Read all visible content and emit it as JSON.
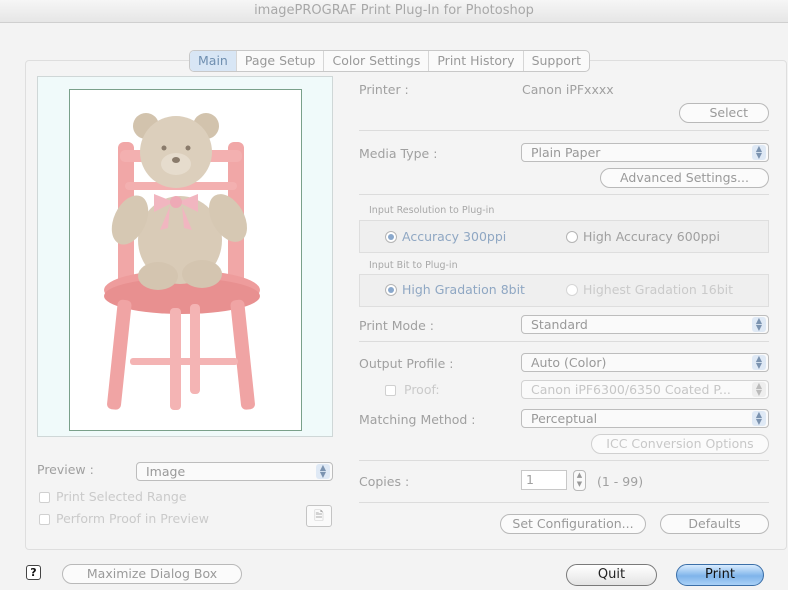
{
  "window": {
    "title": "imagePROGRAF Print Plug-In for Photoshop"
  },
  "tabs": [
    "Main",
    "Page Setup",
    "Color Settings",
    "Print History",
    "Support"
  ],
  "printer": {
    "label": "Printer :",
    "value": "Canon iPFxxxx",
    "select_button": "Select"
  },
  "media": {
    "label": "Media Type :",
    "value": "Plain Paper",
    "advanced_button": "Advanced Settings..."
  },
  "input_resolution": {
    "group_label": "Input Resolution to Plug-in",
    "option1": "Accuracy 300ppi",
    "option2": "High Accuracy 600ppi"
  },
  "input_bit": {
    "group_label": "Input Bit to Plug-in",
    "option1": "High Gradation 8bit",
    "option2": "Highest Gradation 16bit"
  },
  "print_mode": {
    "label": "Print Mode :",
    "value": "Standard"
  },
  "output_profile": {
    "label": "Output Profile :",
    "value": "Auto (Color)"
  },
  "proof": {
    "label": "Proof:",
    "value": "Canon iPF6300/6350 Coated P..."
  },
  "matching": {
    "label": "Matching Method :",
    "value": "Perceptual",
    "icc_button": "ICC Conversion Options"
  },
  "copies": {
    "label": "Copies :",
    "value": "1",
    "range": "(1 - 99)"
  },
  "bottom_buttons": {
    "set_config": "Set Configuration...",
    "defaults": "Defaults"
  },
  "preview": {
    "label": "Preview :",
    "value": "Image",
    "print_selected": "Print Selected Range",
    "perform_proof": "Perform Proof in Preview"
  },
  "footer": {
    "help": "?",
    "maximize": "Maximize Dialog Box",
    "quit": "Quit",
    "print": "Print"
  }
}
